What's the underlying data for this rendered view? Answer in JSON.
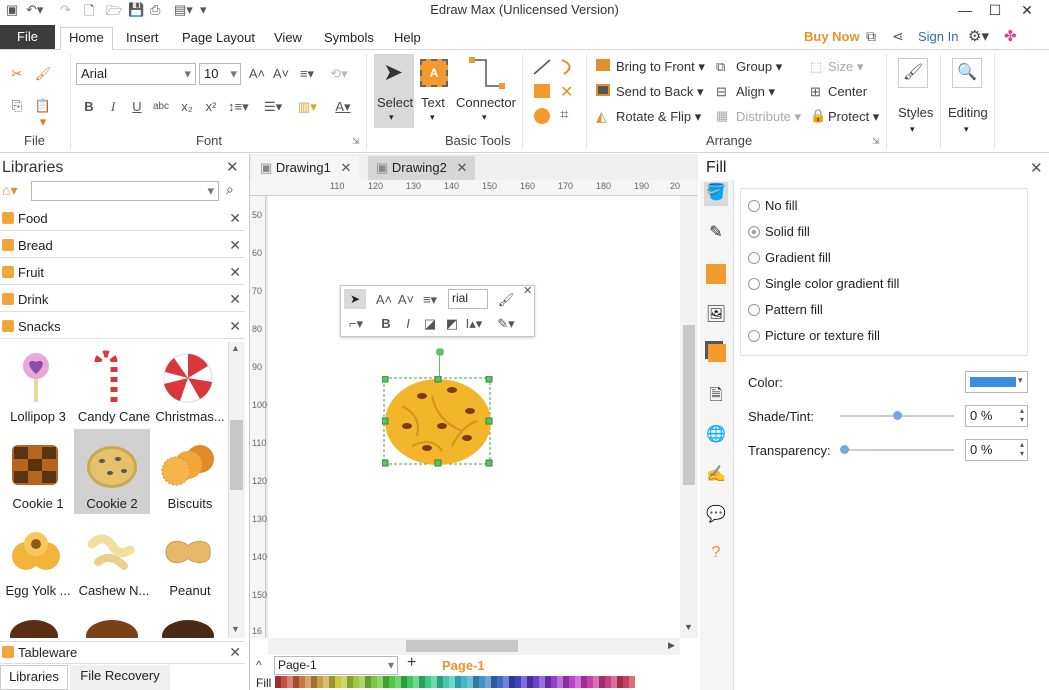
{
  "app": {
    "title": "Edraw Max (Unlicensed Version)"
  },
  "window": {
    "minimize": "—",
    "maximize": "☐",
    "close": "✕"
  },
  "menu": {
    "file": "File",
    "tabs": [
      "Home",
      "Insert",
      "Page Layout",
      "View",
      "Symbols",
      "Help"
    ],
    "buy_now": "Buy Now",
    "sign_in": "Sign In"
  },
  "ribbon": {
    "font_name": "Arial",
    "font_size": "10",
    "groups": {
      "file": "File",
      "font": "Font",
      "basic_tools": "Basic Tools",
      "arrange": "Arrange"
    },
    "select": "Select",
    "text": "Text",
    "connector": "Connector",
    "bring_front": "Bring to Front",
    "send_back": "Send to Back",
    "rotate_flip": "Rotate & Flip",
    "group": "Group",
    "align": "Align",
    "distribute": "Distribute",
    "size": "Size",
    "center": "Center",
    "protect": "Protect",
    "styles": "Styles",
    "editing": "Editing"
  },
  "libraries": {
    "title": "Libraries",
    "categories": [
      "Food",
      "Bread",
      "Fruit",
      "Drink",
      "Snacks"
    ],
    "shapes": [
      "Lollipop 3",
      "Candy Cane",
      "Christmas...",
      "Cookie 1",
      "Cookie 2",
      "Biscuits",
      "Egg Yolk ...",
      "Cashew N...",
      "Peanut"
    ],
    "bottom_category": "Tableware",
    "bottom_tabs": [
      "Libraries",
      "File Recovery"
    ]
  },
  "documents": {
    "tabs": [
      "Drawing1",
      "Drawing2"
    ]
  },
  "ruler": {
    "h": [
      "110",
      "110",
      "120",
      "130",
      "140",
      "150",
      "160",
      "170",
      "180",
      "190",
      "20"
    ],
    "v": [
      "50",
      "60",
      "70",
      "80",
      "90",
      "100",
      "110",
      "120",
      "130",
      "140",
      "150",
      "16"
    ]
  },
  "floating_toolbar": {
    "font": "rial"
  },
  "pages": {
    "current": "Page-1",
    "tab": "Page-1",
    "fill_label": "Fill"
  },
  "fill": {
    "title": "Fill",
    "options": [
      "No fill",
      "Solid fill",
      "Gradient fill",
      "Single color gradient fill",
      "Pattern fill",
      "Picture or texture fill"
    ],
    "selected": "Solid fill",
    "color_label": "Color:",
    "color_value": "#3a8ee0",
    "shade_label": "Shade/Tint:",
    "shade_value": "0 %",
    "transparency_label": "Transparency:",
    "transparency_value": "0 %"
  },
  "colors": {
    "accent": "#e8952a",
    "file_bg": "#3c3c3c"
  }
}
